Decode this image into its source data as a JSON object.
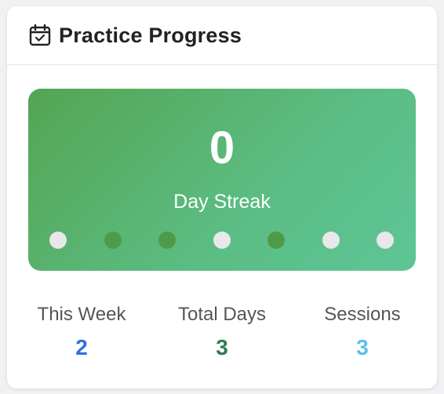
{
  "header": {
    "title": "Practice Progress",
    "icon": "calendar-check-icon"
  },
  "streak": {
    "count": "0",
    "label": "Day Streak",
    "days_completed": [
      false,
      true,
      true,
      false,
      true,
      false,
      false
    ],
    "colors": {
      "completed": "#4f9a48",
      "pending": "#e8e8ec"
    }
  },
  "stats": [
    {
      "label": "This Week",
      "value": "2",
      "color": "#2f6fe4"
    },
    {
      "label": "Total Days",
      "value": "3",
      "color": "#2e7d4f"
    },
    {
      "label": "Sessions",
      "value": "3",
      "color": "#5bc0eb"
    }
  ]
}
